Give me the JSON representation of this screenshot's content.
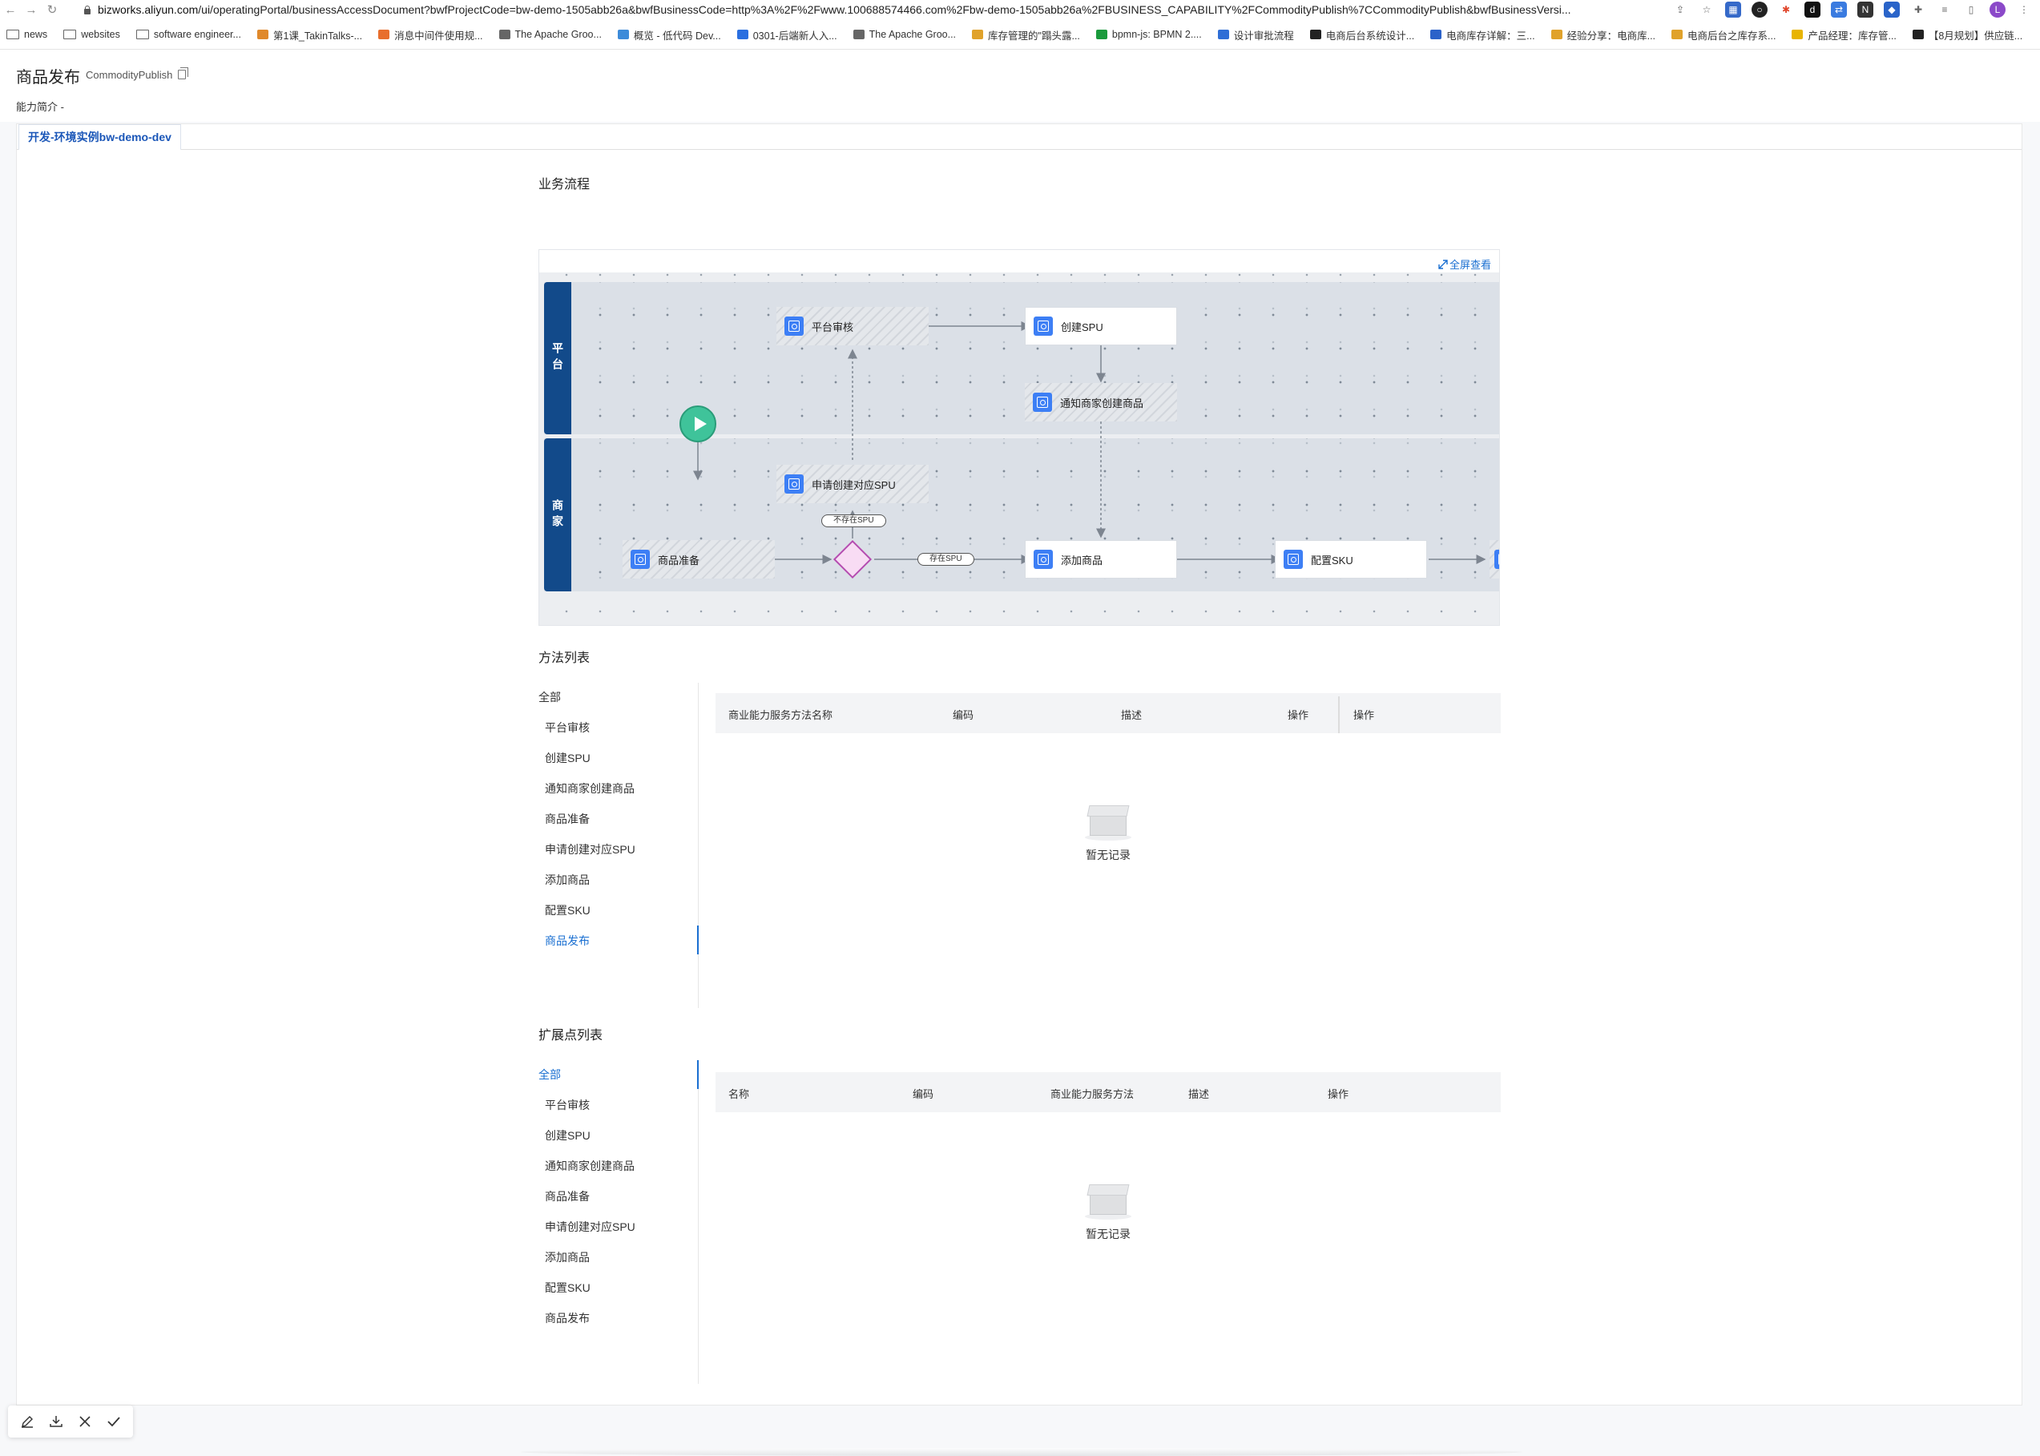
{
  "browser": {
    "url_host": "bizworks.aliyun.com",
    "url_path": "/ui/operatingPortal/businessAccessDocument?bwfProjectCode=bw-demo-1505abb26a&bwfBusinessCode=http%3A%2F%2Fwww.100688574466.com%2Fbw-demo-1505abb26a%2FBUSINESS_CAPABILITY%2FCommodityPublish%7CCommodityPublish&bwfBusinessVersi...",
    "bookmarks": [
      {
        "label": "news",
        "icon": "folder-icon"
      },
      {
        "label": "websites",
        "icon": "folder-icon"
      },
      {
        "label": "software engineer...",
        "icon": "folder-icon"
      },
      {
        "label": "第1课_TakinTalks-...",
        "icon": "site-icon",
        "color": "#e0892b"
      },
      {
        "label": "消息中间件使用规...",
        "icon": "site-icon",
        "color": "#e86e2d"
      },
      {
        "label": "The Apache Groo...",
        "icon": "site-icon",
        "color": "#666666"
      },
      {
        "label": "概览 - 低代码 Dev...",
        "icon": "site-icon",
        "color": "#3d8bd9"
      },
      {
        "label": "0301-后端新人入...",
        "icon": "site-icon",
        "color": "#2a6fe0"
      },
      {
        "label": "The Apache Groo...",
        "icon": "site-icon",
        "color": "#666666"
      },
      {
        "label": "库存管理的\"蹋头露...",
        "icon": "site-icon",
        "color": "#e0a22b"
      },
      {
        "label": "bpmn-js: BPMN 2....",
        "icon": "site-icon",
        "color": "#1a9a3c"
      },
      {
        "label": "设计审批流程",
        "icon": "site-icon",
        "color": "#2f6ed6"
      },
      {
        "label": "电商后台系统设计...",
        "icon": "site-icon",
        "color": "#222222"
      },
      {
        "label": "电商库存详解：三...",
        "icon": "site-icon",
        "color": "#2c62c9"
      },
      {
        "label": "经验分享：电商库...",
        "icon": "site-icon",
        "color": "#e0a22b"
      },
      {
        "label": "电商后台之库存系...",
        "icon": "site-icon",
        "color": "#e0a22b"
      },
      {
        "label": "产品经理：库存管...",
        "icon": "site-icon",
        "color": "#e8b400"
      },
      {
        "label": "【8月规划】供应链...",
        "icon": "site-icon",
        "color": "#222222"
      }
    ]
  },
  "header": {
    "title": "商品发布",
    "code": "CommodityPublish",
    "intro": "能力简介  -"
  },
  "tabs": [
    {
      "label": "开发-环境实例bw-demo-dev",
      "active": true
    }
  ],
  "process": {
    "section_title": "业务流程",
    "fullscreen_label": "全屏查看",
    "lanes": [
      {
        "label": "平台"
      },
      {
        "label": "商家"
      }
    ],
    "nodes": {
      "platform_review": "平台审核",
      "create_spu": "创建SPU",
      "notify_merchant": "通知商家创建商品",
      "apply_spu": "申请创建对应SPU",
      "prepare_goods": "商品准备",
      "add_goods": "添加商品",
      "config_sku": "配置SKU"
    },
    "edge_labels": {
      "no_spu": "不存在SPU",
      "has_spu": "存在SPU"
    }
  },
  "methods": {
    "section_title": "方法列表",
    "menu": [
      "全部",
      "平台审核",
      "创建SPU",
      "通知商家创建商品",
      "商品准备",
      "申请创建对应SPU",
      "添加商品",
      "配置SKU",
      "商品发布"
    ],
    "active_index": 8,
    "columns": [
      "商业能力服务方法名称",
      "编码",
      "描述",
      "操作",
      "操作"
    ],
    "empty_text": "暂无记录"
  },
  "extensions": {
    "section_title": "扩展点列表",
    "menu": [
      "全部",
      "平台审核",
      "创建SPU",
      "通知商家创建商品",
      "商品准备",
      "申请创建对应SPU",
      "添加商品",
      "配置SKU",
      "商品发布"
    ],
    "active_index": 0,
    "columns": [
      "名称",
      "编码",
      "商业能力服务方法",
      "描述",
      "操作"
    ],
    "empty_text": "暂无记录"
  },
  "toolbar": {
    "items": [
      "edit-icon",
      "download-icon",
      "close-icon",
      "check-icon"
    ]
  },
  "colors": {
    "accent": "#1a6fd1",
    "lane_header": "#124a8a",
    "task_icon": "#3d7ff5",
    "start_event": "#3fc39a",
    "gateway": "#b44cb0"
  }
}
